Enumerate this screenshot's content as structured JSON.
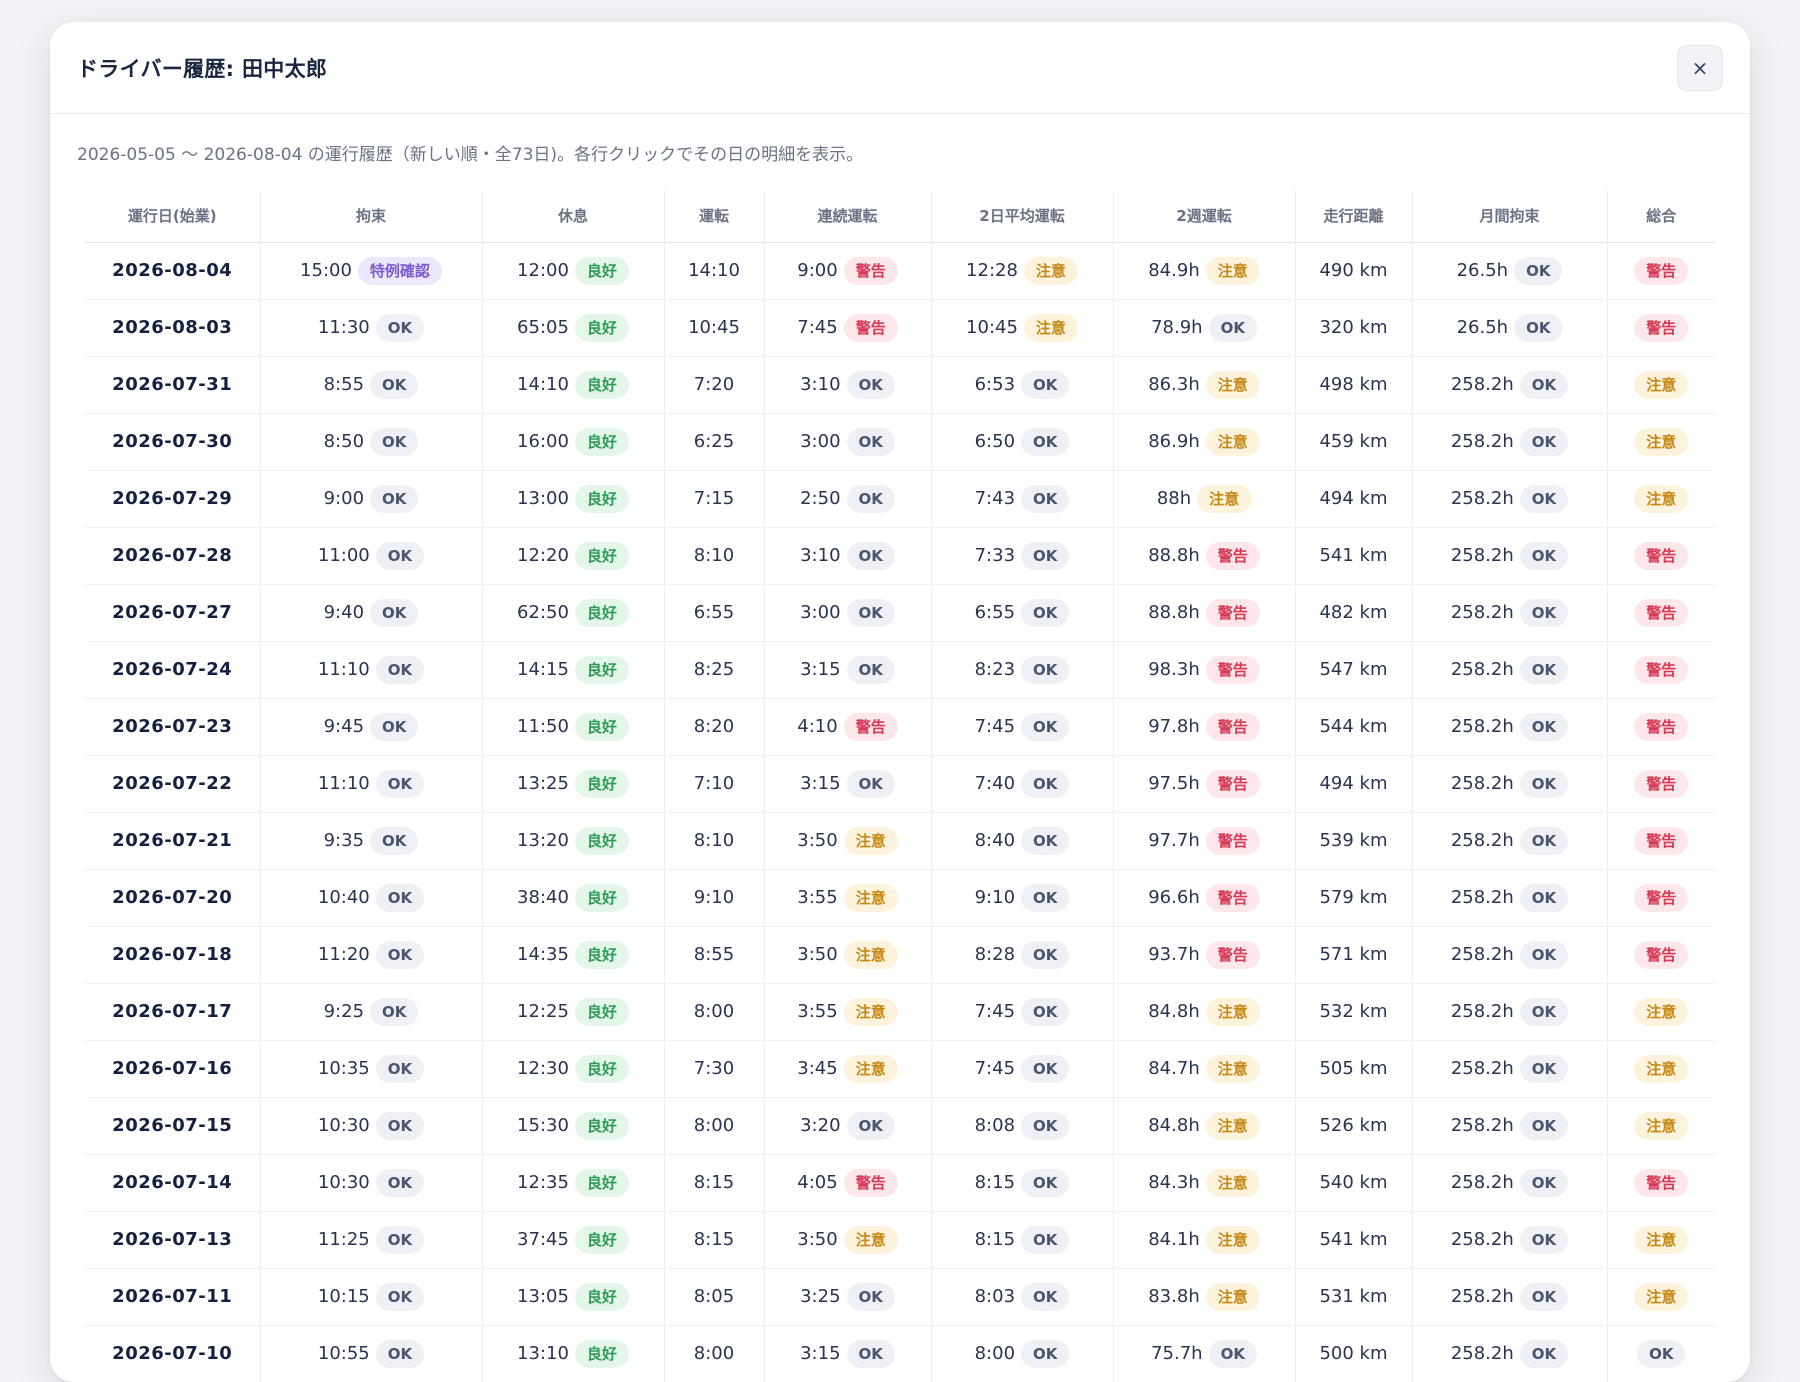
{
  "modal": {
    "title": "ドライバー履歴: 田中太郎",
    "close_label": "×",
    "description": "2026-05-05 〜 2026-08-04 の運行履歴（新しい順・全73日)。各行クリックでその日の明細を表示。"
  },
  "columns": [
    "運行日(始業)",
    "拘束",
    "休息",
    "運転",
    "連続運転",
    "2日平均運転",
    "2週運転",
    "走行距離",
    "月間拘束",
    "総合"
  ],
  "badge_labels": {
    "ok": "OK",
    "good": "良好",
    "warn": "警告",
    "caution": "注意",
    "special": "特例確認"
  },
  "rows": [
    {
      "date": "2026-08-04",
      "restraint": "15:00",
      "restraint_s": "special",
      "rest": "12:00",
      "rest_s": "good",
      "drive": "14:10",
      "cont": "9:00",
      "cont_s": "warn",
      "avg2": "12:28",
      "avg2_s": "caution",
      "week2": "84.9h",
      "week2_s": "caution",
      "dist": "490 km",
      "monthly": "26.5h",
      "monthly_s": "ok",
      "overall_s": "warn"
    },
    {
      "date": "2026-08-03",
      "restraint": "11:30",
      "restraint_s": "ok",
      "rest": "65:05",
      "rest_s": "good",
      "drive": "10:45",
      "cont": "7:45",
      "cont_s": "warn",
      "avg2": "10:45",
      "avg2_s": "caution",
      "week2": "78.9h",
      "week2_s": "ok",
      "dist": "320 km",
      "monthly": "26.5h",
      "monthly_s": "ok",
      "overall_s": "warn"
    },
    {
      "date": "2026-07-31",
      "restraint": "8:55",
      "restraint_s": "ok",
      "rest": "14:10",
      "rest_s": "good",
      "drive": "7:20",
      "cont": "3:10",
      "cont_s": "ok",
      "avg2": "6:53",
      "avg2_s": "ok",
      "week2": "86.3h",
      "week2_s": "caution",
      "dist": "498 km",
      "monthly": "258.2h",
      "monthly_s": "ok",
      "overall_s": "caution"
    },
    {
      "date": "2026-07-30",
      "restraint": "8:50",
      "restraint_s": "ok",
      "rest": "16:00",
      "rest_s": "good",
      "drive": "6:25",
      "cont": "3:00",
      "cont_s": "ok",
      "avg2": "6:50",
      "avg2_s": "ok",
      "week2": "86.9h",
      "week2_s": "caution",
      "dist": "459 km",
      "monthly": "258.2h",
      "monthly_s": "ok",
      "overall_s": "caution"
    },
    {
      "date": "2026-07-29",
      "restraint": "9:00",
      "restraint_s": "ok",
      "rest": "13:00",
      "rest_s": "good",
      "drive": "7:15",
      "cont": "2:50",
      "cont_s": "ok",
      "avg2": "7:43",
      "avg2_s": "ok",
      "week2": "88h",
      "week2_s": "caution",
      "dist": "494 km",
      "monthly": "258.2h",
      "monthly_s": "ok",
      "overall_s": "caution"
    },
    {
      "date": "2026-07-28",
      "restraint": "11:00",
      "restraint_s": "ok",
      "rest": "12:20",
      "rest_s": "good",
      "drive": "8:10",
      "cont": "3:10",
      "cont_s": "ok",
      "avg2": "7:33",
      "avg2_s": "ok",
      "week2": "88.8h",
      "week2_s": "warn",
      "dist": "541 km",
      "monthly": "258.2h",
      "monthly_s": "ok",
      "overall_s": "warn"
    },
    {
      "date": "2026-07-27",
      "restraint": "9:40",
      "restraint_s": "ok",
      "rest": "62:50",
      "rest_s": "good",
      "drive": "6:55",
      "cont": "3:00",
      "cont_s": "ok",
      "avg2": "6:55",
      "avg2_s": "ok",
      "week2": "88.8h",
      "week2_s": "warn",
      "dist": "482 km",
      "monthly": "258.2h",
      "monthly_s": "ok",
      "overall_s": "warn"
    },
    {
      "date": "2026-07-24",
      "restraint": "11:10",
      "restraint_s": "ok",
      "rest": "14:15",
      "rest_s": "good",
      "drive": "8:25",
      "cont": "3:15",
      "cont_s": "ok",
      "avg2": "8:23",
      "avg2_s": "ok",
      "week2": "98.3h",
      "week2_s": "warn",
      "dist": "547 km",
      "monthly": "258.2h",
      "monthly_s": "ok",
      "overall_s": "warn"
    },
    {
      "date": "2026-07-23",
      "restraint": "9:45",
      "restraint_s": "ok",
      "rest": "11:50",
      "rest_s": "good",
      "drive": "8:20",
      "cont": "4:10",
      "cont_s": "warn",
      "avg2": "7:45",
      "avg2_s": "ok",
      "week2": "97.8h",
      "week2_s": "warn",
      "dist": "544 km",
      "monthly": "258.2h",
      "monthly_s": "ok",
      "overall_s": "warn"
    },
    {
      "date": "2026-07-22",
      "restraint": "11:10",
      "restraint_s": "ok",
      "rest": "13:25",
      "rest_s": "good",
      "drive": "7:10",
      "cont": "3:15",
      "cont_s": "ok",
      "avg2": "7:40",
      "avg2_s": "ok",
      "week2": "97.5h",
      "week2_s": "warn",
      "dist": "494 km",
      "monthly": "258.2h",
      "monthly_s": "ok",
      "overall_s": "warn"
    },
    {
      "date": "2026-07-21",
      "restraint": "9:35",
      "restraint_s": "ok",
      "rest": "13:20",
      "rest_s": "good",
      "drive": "8:10",
      "cont": "3:50",
      "cont_s": "caution",
      "avg2": "8:40",
      "avg2_s": "ok",
      "week2": "97.7h",
      "week2_s": "warn",
      "dist": "539 km",
      "monthly": "258.2h",
      "monthly_s": "ok",
      "overall_s": "warn"
    },
    {
      "date": "2026-07-20",
      "restraint": "10:40",
      "restraint_s": "ok",
      "rest": "38:40",
      "rest_s": "good",
      "drive": "9:10",
      "cont": "3:55",
      "cont_s": "caution",
      "avg2": "9:10",
      "avg2_s": "ok",
      "week2": "96.6h",
      "week2_s": "warn",
      "dist": "579 km",
      "monthly": "258.2h",
      "monthly_s": "ok",
      "overall_s": "warn"
    },
    {
      "date": "2026-07-18",
      "restraint": "11:20",
      "restraint_s": "ok",
      "rest": "14:35",
      "rest_s": "good",
      "drive": "8:55",
      "cont": "3:50",
      "cont_s": "caution",
      "avg2": "8:28",
      "avg2_s": "ok",
      "week2": "93.7h",
      "week2_s": "warn",
      "dist": "571 km",
      "monthly": "258.2h",
      "monthly_s": "ok",
      "overall_s": "warn"
    },
    {
      "date": "2026-07-17",
      "restraint": "9:25",
      "restraint_s": "ok",
      "rest": "12:25",
      "rest_s": "good",
      "drive": "8:00",
      "cont": "3:55",
      "cont_s": "caution",
      "avg2": "7:45",
      "avg2_s": "ok",
      "week2": "84.8h",
      "week2_s": "caution",
      "dist": "532 km",
      "monthly": "258.2h",
      "monthly_s": "ok",
      "overall_s": "caution"
    },
    {
      "date": "2026-07-16",
      "restraint": "10:35",
      "restraint_s": "ok",
      "rest": "12:30",
      "rest_s": "good",
      "drive": "7:30",
      "cont": "3:45",
      "cont_s": "caution",
      "avg2": "7:45",
      "avg2_s": "ok",
      "week2": "84.7h",
      "week2_s": "caution",
      "dist": "505 km",
      "monthly": "258.2h",
      "monthly_s": "ok",
      "overall_s": "caution"
    },
    {
      "date": "2026-07-15",
      "restraint": "10:30",
      "restraint_s": "ok",
      "rest": "15:30",
      "rest_s": "good",
      "drive": "8:00",
      "cont": "3:20",
      "cont_s": "ok",
      "avg2": "8:08",
      "avg2_s": "ok",
      "week2": "84.8h",
      "week2_s": "caution",
      "dist": "526 km",
      "monthly": "258.2h",
      "monthly_s": "ok",
      "overall_s": "caution"
    },
    {
      "date": "2026-07-14",
      "restraint": "10:30",
      "restraint_s": "ok",
      "rest": "12:35",
      "rest_s": "good",
      "drive": "8:15",
      "cont": "4:05",
      "cont_s": "warn",
      "avg2": "8:15",
      "avg2_s": "ok",
      "week2": "84.3h",
      "week2_s": "caution",
      "dist": "540 km",
      "monthly": "258.2h",
      "monthly_s": "ok",
      "overall_s": "warn"
    },
    {
      "date": "2026-07-13",
      "restraint": "11:25",
      "restraint_s": "ok",
      "rest": "37:45",
      "rest_s": "good",
      "drive": "8:15",
      "cont": "3:50",
      "cont_s": "caution",
      "avg2": "8:15",
      "avg2_s": "ok",
      "week2": "84.1h",
      "week2_s": "caution",
      "dist": "541 km",
      "monthly": "258.2h",
      "monthly_s": "ok",
      "overall_s": "caution"
    },
    {
      "date": "2026-07-11",
      "restraint": "10:15",
      "restraint_s": "ok",
      "rest": "13:05",
      "rest_s": "good",
      "drive": "8:05",
      "cont": "3:25",
      "cont_s": "ok",
      "avg2": "8:03",
      "avg2_s": "ok",
      "week2": "83.8h",
      "week2_s": "caution",
      "dist": "531 km",
      "monthly": "258.2h",
      "monthly_s": "ok",
      "overall_s": "caution"
    },
    {
      "date": "2026-07-10",
      "restraint": "10:55",
      "restraint_s": "ok",
      "rest": "13:10",
      "rest_s": "good",
      "drive": "8:00",
      "cont": "3:15",
      "cont_s": "ok",
      "avg2": "8:00",
      "avg2_s": "ok",
      "week2": "75.7h",
      "week2_s": "ok",
      "dist": "500 km",
      "monthly": "258.2h",
      "monthly_s": "ok",
      "overall_s": "ok"
    }
  ]
}
